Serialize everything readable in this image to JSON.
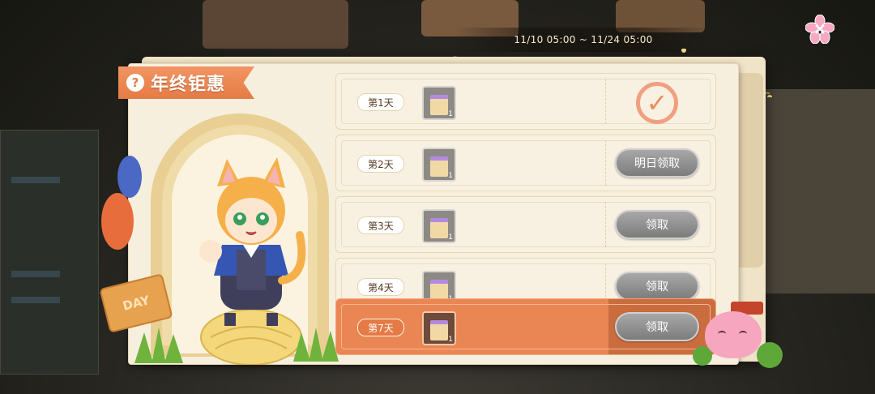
{
  "event": {
    "title": "年终钜惠",
    "help_icon": "?",
    "date_range": "11/10 05:00 ~ 11/24 05:00",
    "sign_text": "DAY"
  },
  "rows": [
    {
      "day": "第1天",
      "qty": "1",
      "status": "claimed",
      "button": ""
    },
    {
      "day": "第2天",
      "qty": "1",
      "status": "tomorrow",
      "button": "明日领取"
    },
    {
      "day": "第3天",
      "qty": "1",
      "status": "claimable",
      "button": "领取"
    },
    {
      "day": "第4天",
      "qty": "1",
      "status": "claimable",
      "button": "领取"
    }
  ],
  "featured_row": {
    "day": "第7天",
    "qty": "1",
    "status": "claimable",
    "button": "领取"
  },
  "colors": {
    "accent": "#e57b45",
    "panel": "#f7efdd",
    "button_gray": "#8c8c8c",
    "claimed_check": "#ec8a62"
  },
  "icons": {
    "help": "help-icon",
    "gift_box": "gift-box-icon",
    "claimed_check": "check-icon",
    "sakura": "sakura-icon"
  }
}
